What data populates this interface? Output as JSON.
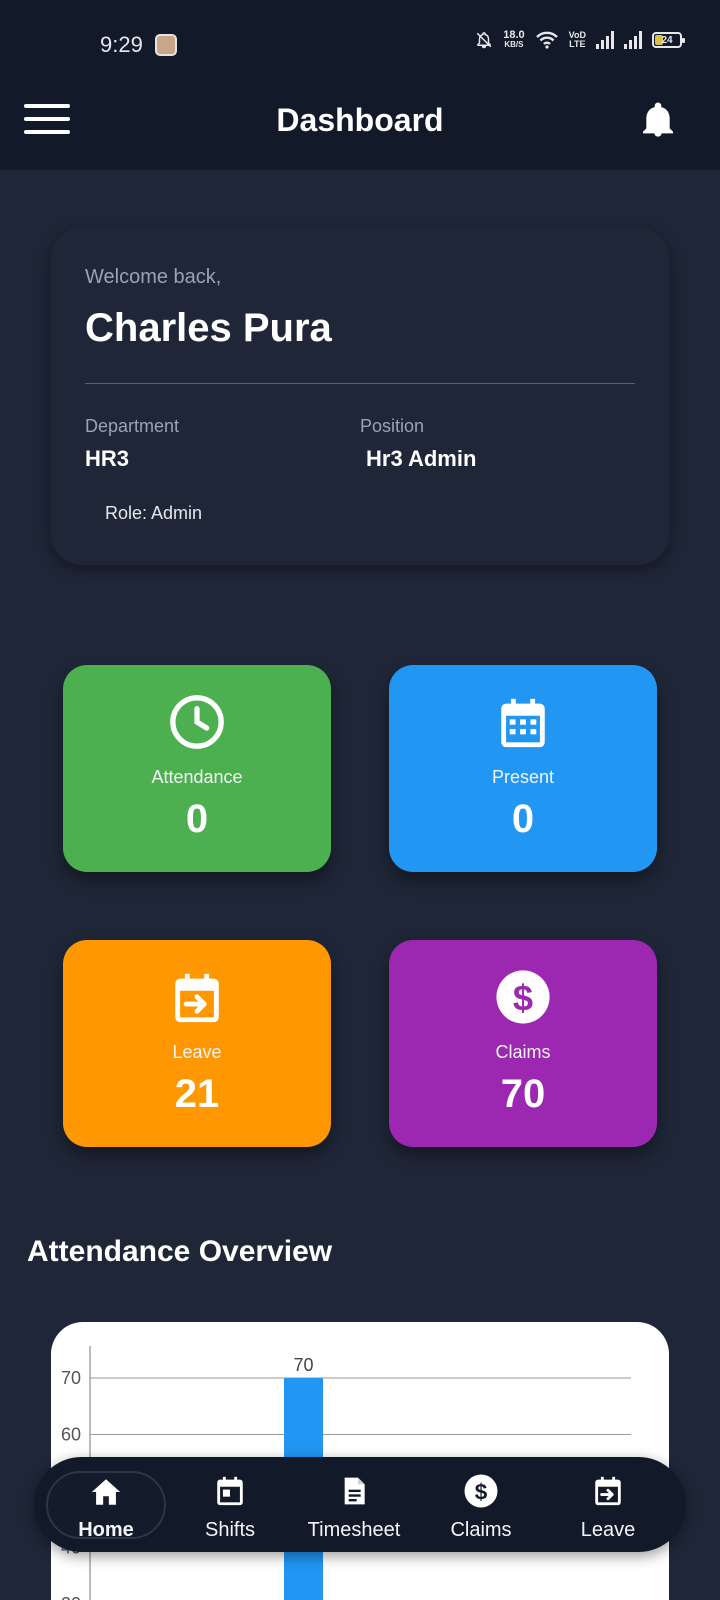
{
  "status_bar": {
    "time": "9:29",
    "net_speed_value": "18.0",
    "net_speed_unit": "KB/S",
    "volte_top": "VoD",
    "volte_bottom": "LTE",
    "battery": "24"
  },
  "app_bar": {
    "title": "Dashboard"
  },
  "welcome": {
    "greeting": "Welcome back,",
    "name": "Charles Pura",
    "department_label": "Department",
    "department_value": "HR3",
    "position_label": "Position",
    "position_value": "Hr3 Admin",
    "role": "Role: Admin"
  },
  "stats": [
    {
      "label": "Attendance",
      "value": "0",
      "color": "#4caf50",
      "icon": "clock-icon"
    },
    {
      "label": "Present",
      "value": "0",
      "color": "#2196f3",
      "icon": "calendar-icon"
    },
    {
      "label": "Leave",
      "value": "21",
      "color": "#ff9800",
      "icon": "calendar-arrow-icon"
    },
    {
      "label": "Claims",
      "value": "70",
      "color": "#9c27b0",
      "icon": "dollar-circle-icon"
    }
  ],
  "overview": {
    "title": "Attendance Overview"
  },
  "chart_data": {
    "type": "bar",
    "title": "",
    "xlabel": "",
    "ylabel": "",
    "y_tick_labels": [
      "70",
      "60",
      "50",
      "40",
      "30"
    ],
    "ylim": [
      0,
      70
    ],
    "bars": [
      {
        "value": 70,
        "label": "70",
        "color": "#2196f3"
      }
    ],
    "grid": true
  },
  "bottom_nav": [
    {
      "label": "Home",
      "icon": "home-icon",
      "active": true
    },
    {
      "label": "Shifts",
      "icon": "calendar-icon",
      "active": false
    },
    {
      "label": "Timesheet",
      "icon": "document-icon",
      "active": false
    },
    {
      "label": "Claims",
      "icon": "dollar-circle-icon",
      "active": false
    },
    {
      "label": "Leave",
      "icon": "calendar-arrow-icon",
      "active": false
    }
  ]
}
